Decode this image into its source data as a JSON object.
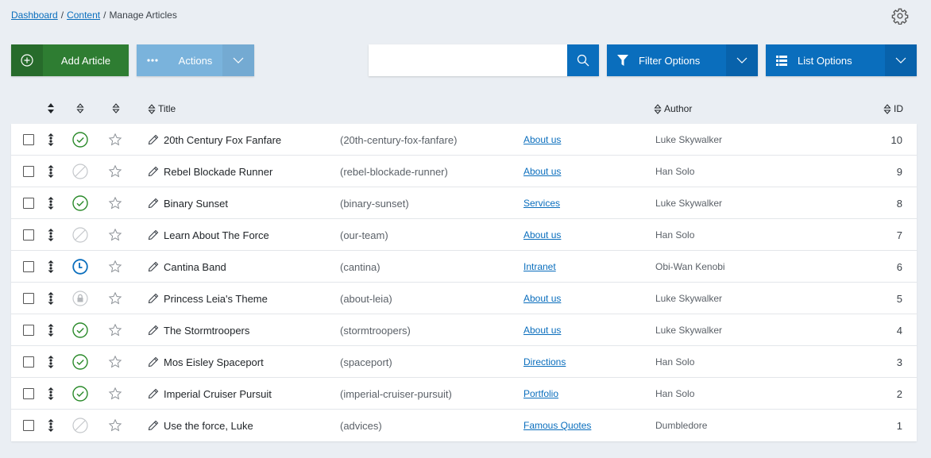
{
  "breadcrumb": {
    "items": [
      {
        "label": "Dashboard",
        "link": true
      },
      {
        "label": "Content",
        "link": true
      },
      {
        "label": "Manage Articles",
        "link": false
      }
    ],
    "separator": "/"
  },
  "toolbar": {
    "add_label": "Add Article",
    "actions_label": "Actions",
    "search_placeholder": "",
    "search_value": "",
    "filter_label": "Filter Options",
    "list_label": "List Options"
  },
  "colors": {
    "add_green": "#2e7d32",
    "primary_blue": "#0a6ebd",
    "actions_disabled": "#7ab3dc",
    "published_green": "#2a8a2a",
    "scheduled_blue": "#0a6ebd"
  },
  "table": {
    "headers": {
      "title": "Title",
      "author": "Author",
      "id": "ID"
    },
    "rows": [
      {
        "status": "published",
        "title": "20th Century Fox Fanfare",
        "alias": "(20th-century-fox-fanfare)",
        "category": "About us",
        "author": "Luke Skywalker",
        "id": "10"
      },
      {
        "status": "unpublished",
        "title": "Rebel Blockade Runner",
        "alias": "(rebel-blockade-runner)",
        "category": "About us",
        "author": "Han Solo",
        "id": "9"
      },
      {
        "status": "published",
        "title": "Binary Sunset",
        "alias": "(binary-sunset)",
        "category": "Services",
        "author": "Luke Skywalker",
        "id": "8"
      },
      {
        "status": "unpublished",
        "title": "Learn About The Force",
        "alias": "(our-team)",
        "category": "About us",
        "author": "Han Solo",
        "id": "7"
      },
      {
        "status": "scheduled",
        "title": "Cantina Band",
        "alias": "(cantina)",
        "category": "Intranet",
        "author": "Obi-Wan Kenobi",
        "id": "6"
      },
      {
        "status": "locked",
        "title": "Princess Leia's Theme",
        "alias": "(about-leia)",
        "category": "About us",
        "author": "Luke Skywalker",
        "id": "5"
      },
      {
        "status": "published",
        "title": "The Stormtroopers",
        "alias": "(stormtroopers)",
        "category": "About us",
        "author": "Luke Skywalker",
        "id": "4"
      },
      {
        "status": "published",
        "title": "Mos Eisley Spaceport",
        "alias": "(spaceport)",
        "category": "Directions",
        "author": "Han Solo",
        "id": "3"
      },
      {
        "status": "published",
        "title": "Imperial Cruiser Pursuit",
        "alias": "(imperial-cruiser-pursuit)",
        "category": "Portfolio",
        "author": "Han Solo",
        "id": "2"
      },
      {
        "status": "unpublished",
        "title": "Use the force, Luke",
        "alias": "(advices)",
        "category": "Famous Quotes",
        "author": "Dumbledore",
        "id": "1"
      }
    ]
  }
}
